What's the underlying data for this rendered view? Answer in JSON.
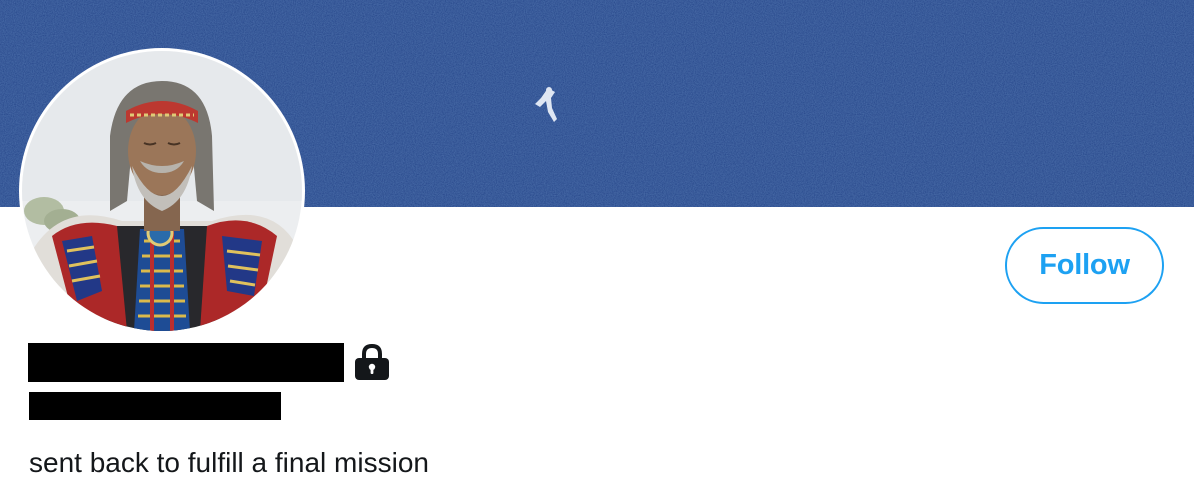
{
  "profile": {
    "banner": {
      "description": "",
      "color": "#1c3f86"
    },
    "avatar": {
      "description": ""
    },
    "follow_label": "Follow",
    "name": "",
    "handle": "",
    "protected_icon": "lock-icon",
    "bio": "sent back to fulfill a final mission"
  },
  "colors": {
    "accent": "#1da1f2",
    "text": "#14171a",
    "banner": "#1c3f86"
  }
}
